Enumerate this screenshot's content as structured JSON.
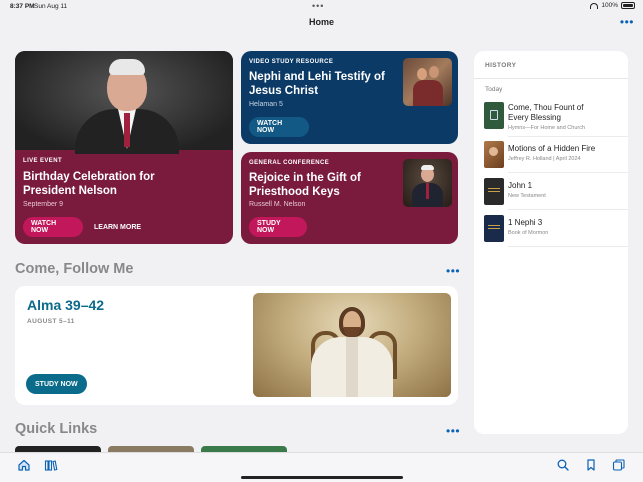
{
  "status": {
    "time": "8:37 PM",
    "date": "Sun Aug 11",
    "battery": "100%",
    "battery_level": 1.0
  },
  "nav": {
    "title": "Home",
    "more": "•••"
  },
  "cards": {
    "birthday": {
      "eyebrow": "LIVE EVENT",
      "title_line1": "Birthday Celebration for",
      "title_line2": "President Nelson",
      "date": "September 9",
      "watch_label": "WATCH NOW",
      "learn_label": "LEARN MORE"
    },
    "video": {
      "eyebrow": "VIDEO STUDY RESOURCE",
      "title_line1": "Nephi and Lehi Testify of",
      "title_line2": "Jesus Christ",
      "subtitle": "Helaman 5",
      "watch_label": "WATCH NOW"
    },
    "conference": {
      "eyebrow": "GENERAL CONFERENCE",
      "title_line1": "Rejoice in the Gift of",
      "title_line2": "Priesthood Keys",
      "subtitle": "Russell M. Nelson",
      "study_label": "STUDY NOW"
    }
  },
  "come_follow_me": {
    "section_title": "Come, Follow Me",
    "more": "•••",
    "title": "Alma 39–42",
    "date": "AUGUST 5–11",
    "study_label": "STUDY NOW"
  },
  "quick_links": {
    "section_title": "Quick Links",
    "more": "•••"
  },
  "history": {
    "title": "HISTORY",
    "group": "Today",
    "items": [
      {
        "title_line1": "Come, Thou Fount of",
        "title_line2": "Every Blessing",
        "subtitle": "Hymns—For Home and Church",
        "thumb_color": "#2f5a3c"
      },
      {
        "title_line1": "Motions of a Hidden Fire",
        "title_line2": "",
        "subtitle": "Jeffrey R. Holland | April 2024",
        "thumb_color": "#7a4a2a"
      },
      {
        "title_line1": "John 1",
        "title_line2": "",
        "subtitle": "New Testament",
        "thumb_color": "#2a2a2a"
      },
      {
        "title_line1": "1 Nephi 3",
        "title_line2": "",
        "subtitle": "Book of Mormon",
        "thumb_color": "#1a2a4a"
      }
    ]
  },
  "colors": {
    "maroon": "#7a1a3d",
    "navy": "#0c3a66",
    "teal": "#0b6b8a",
    "accent": "#0a62b5",
    "pink_button": "#c2185b"
  },
  "tabbar": {
    "left_icons": [
      "home-icon",
      "library-icon"
    ],
    "right_icons": [
      "search-icon",
      "bookmark-icon",
      "windows-icon"
    ]
  }
}
